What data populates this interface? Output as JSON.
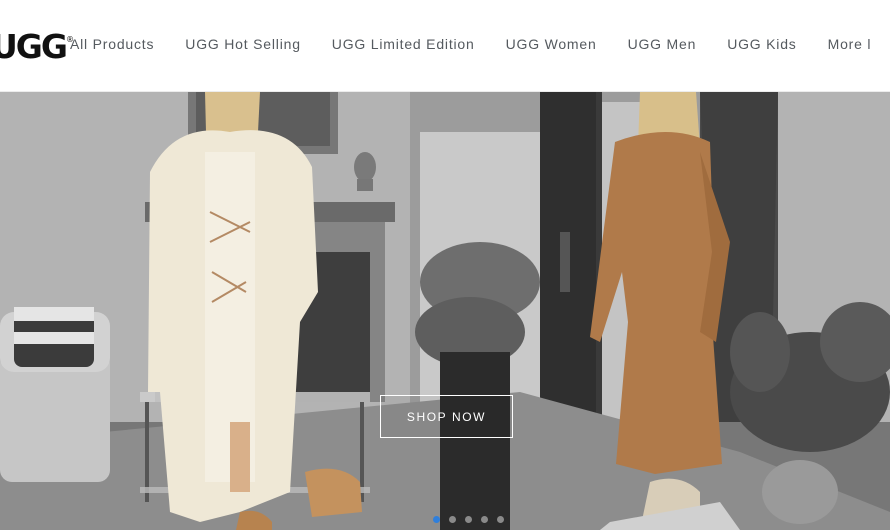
{
  "header": {
    "logo_text": "UGG",
    "nav": [
      {
        "label": "All Products"
      },
      {
        "label": "UGG Hot Selling"
      },
      {
        "label": "UGG Limited Edition"
      },
      {
        "label": "UGG Women"
      },
      {
        "label": "UGG Men"
      },
      {
        "label": "UGG Kids"
      },
      {
        "label": "More l"
      }
    ]
  },
  "hero": {
    "cta_label": "SHOP NOW",
    "slides_total": 5,
    "active_slide": 1
  },
  "colors": {
    "nav_text": "#555a5f",
    "active_dot": "#2f7fdc",
    "dress_brown": "#b07a4a",
    "cardigan_cream": "#efe8d6"
  },
  "icons": [
    "ugg-logo",
    "carousel-dot"
  ]
}
